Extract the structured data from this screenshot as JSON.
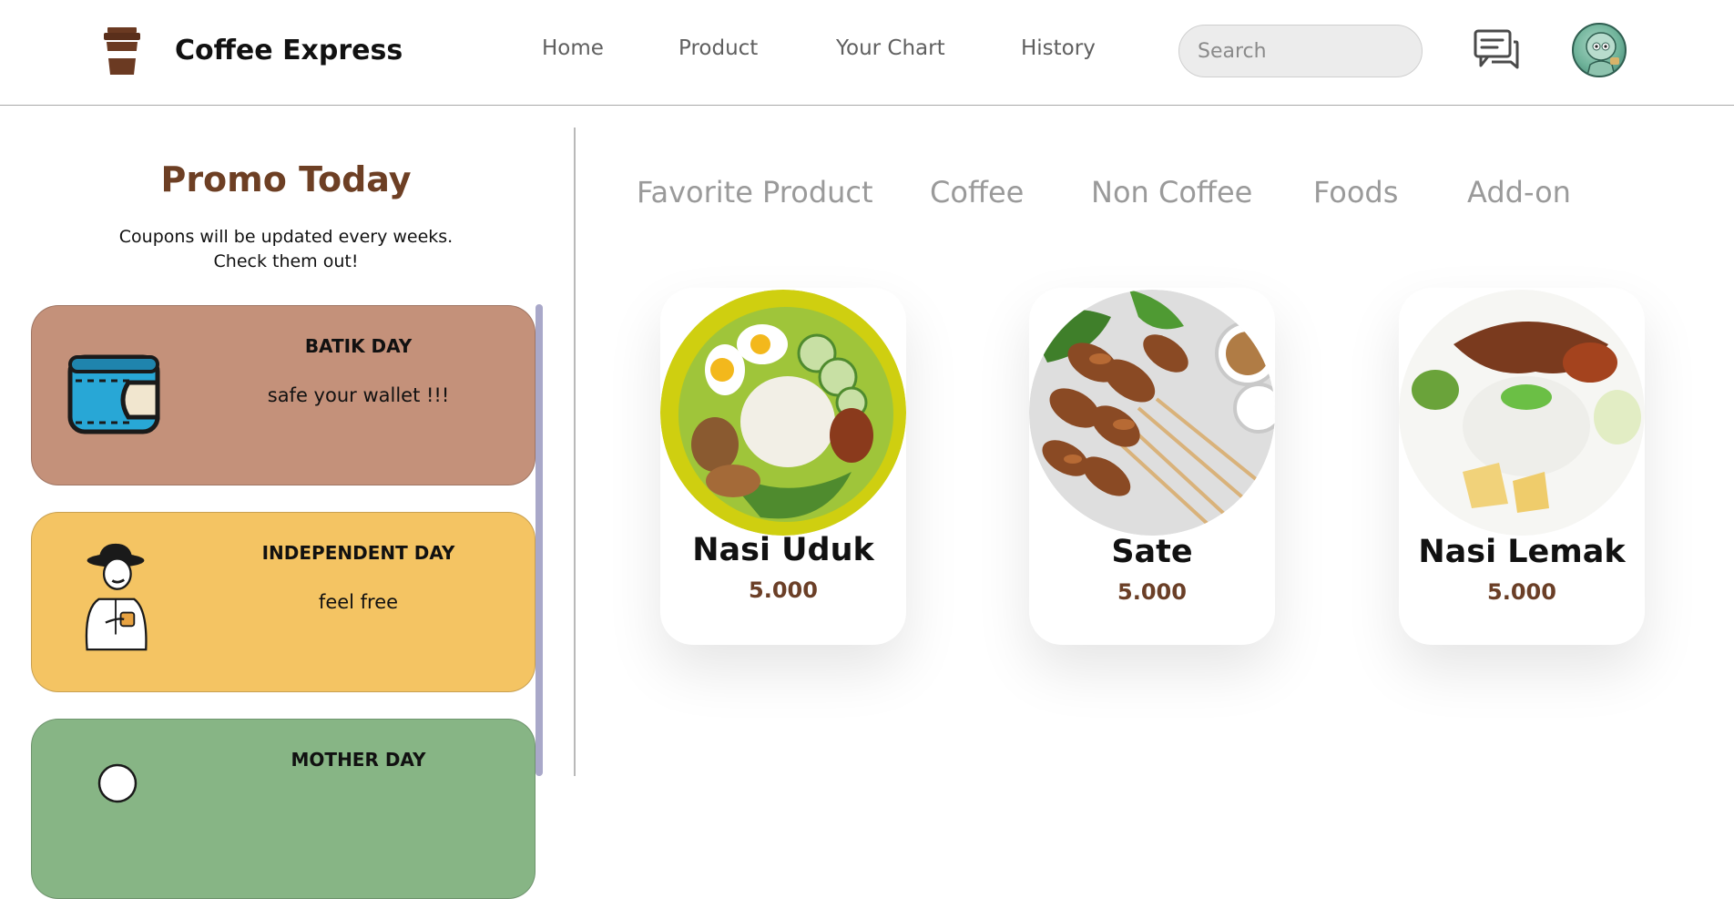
{
  "header": {
    "brand_name": "Coffee Express",
    "nav": [
      "Home",
      "Product",
      "Your Chart",
      "History"
    ],
    "search_placeholder": "Search",
    "icons": {
      "logo": "coffee-cup-icon",
      "chat": "chat-icon",
      "avatar": "user-avatar"
    }
  },
  "sidebar": {
    "title": "Promo Today",
    "subtitle_line1": "Coupons will be updated every weeks.",
    "subtitle_line2": "Check them out!",
    "coupons": [
      {
        "title": "BATIK DAY",
        "description": "safe your wallet !!!",
        "color": "#c4917a",
        "icon": "wallet-icon"
      },
      {
        "title": "INDEPENDENT DAY",
        "description": "feel free",
        "color": "#f4c463",
        "icon": "man-with-coffee-icon"
      },
      {
        "title": "MOTHER DAY",
        "description": "",
        "color": "#87b585",
        "icon": "woman-icon"
      }
    ]
  },
  "tabs": [
    "Favorite Product",
    "Coffee",
    "Non Coffee",
    "Foods",
    "Add-on"
  ],
  "products": [
    {
      "name": "Nasi Uduk",
      "price": "5.000",
      "image": "nasi-uduk-image"
    },
    {
      "name": "Sate",
      "price": "5.000",
      "image": "sate-image"
    },
    {
      "name": "Nasi Lemak",
      "price": "5.000",
      "image": "nasi-lemak-image"
    }
  ],
  "colors": {
    "accent_brown": "#6d3f24",
    "price_brown": "#6b3f27",
    "scrollbar": "#a9a8c9"
  }
}
